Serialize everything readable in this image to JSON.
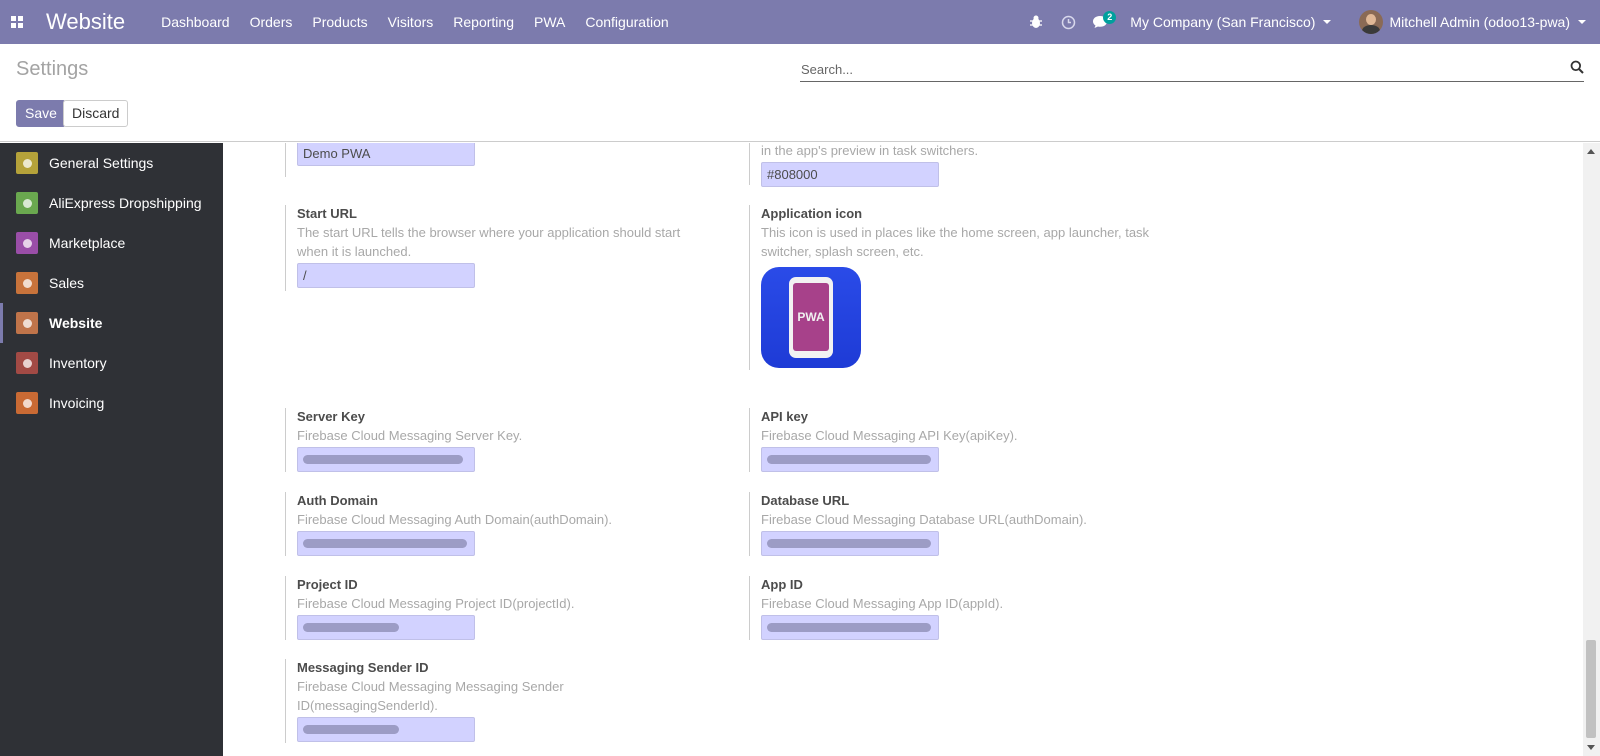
{
  "navbar": {
    "app_title": "Website",
    "menu": [
      "Dashboard",
      "Orders",
      "Products",
      "Visitors",
      "Reporting",
      "PWA",
      "Configuration"
    ],
    "messages_count": "2",
    "company": "My Company (San Francisco)",
    "user": "Mitchell Admin (odoo13-pwa)",
    "accent_color": "#7c7bad"
  },
  "control_panel": {
    "title": "Settings",
    "search_placeholder": "Search...",
    "save_label": "Save",
    "discard_label": "Discard"
  },
  "sidebar": {
    "items": [
      {
        "label": "General Settings",
        "icon": "gear-icon",
        "color": "#b5a23a"
      },
      {
        "label": "AliExpress Dropshipping",
        "icon": "aliexpress-icon",
        "color": "#6aa84f"
      },
      {
        "label": "Marketplace",
        "icon": "marketplace-icon",
        "color": "#9a4ea8"
      },
      {
        "label": "Sales",
        "icon": "sales-chart-icon",
        "color": "#c8733b"
      },
      {
        "label": "Website",
        "icon": "globe-icon",
        "color": "#c0744a"
      },
      {
        "label": "Inventory",
        "icon": "box-icon",
        "color": "#a24a45"
      },
      {
        "label": "Invoicing",
        "icon": "invoice-icon",
        "color": "#c96a34"
      }
    ],
    "active": "Website"
  },
  "settings": {
    "app_name_value": "Demo PWA",
    "theme_color_help": "in the app's preview in task switchers.",
    "theme_color_value": "#808000",
    "start_url": {
      "label": "Start URL",
      "help": "The start URL tells the browser where your application should start when it is launched.",
      "value": "/"
    },
    "app_icon": {
      "label": "Application icon",
      "help": "This icon is used in places like the home screen, app launcher, task switcher, splash screen, etc.",
      "icon_text": "PWA"
    },
    "server_key": {
      "label": "Server Key",
      "help": "Firebase Cloud Messaging Server Key."
    },
    "api_key": {
      "label": "API key",
      "help": "Firebase Cloud Messaging API Key(apiKey)."
    },
    "auth_domain": {
      "label": "Auth Domain",
      "help": "Firebase Cloud Messaging Auth Domain(authDomain)."
    },
    "database_url": {
      "label": "Database URL",
      "help": "Firebase Cloud Messaging Database URL(authDomain)."
    },
    "project_id": {
      "label": "Project ID",
      "help": "Firebase Cloud Messaging Project ID(projectId)."
    },
    "app_id": {
      "label": "App ID",
      "help": "Firebase Cloud Messaging App ID(appId)."
    },
    "sender_id": {
      "label": "Messaging Sender ID",
      "help": "Firebase Cloud Messaging Messaging Sender ID(messagingSenderId)."
    }
  }
}
